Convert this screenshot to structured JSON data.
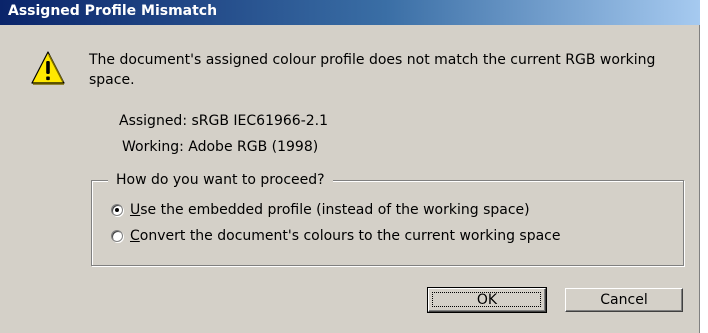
{
  "window": {
    "title": "Assigned Profile Mismatch"
  },
  "icon": {
    "name": "warning-icon",
    "fill": "#ffe800",
    "glyph": "!"
  },
  "message": "The document's assigned colour profile does not match the current RGB working space.",
  "assigned_text": "Assigned: sRGB IEC61966-2.1",
  "working_text": "Working: Adobe RGB (1998)",
  "group": {
    "legend": "How do you want to proceed?",
    "options": [
      {
        "accel": "U",
        "rest": "se the embedded profile (instead of the working space)",
        "selected": true
      },
      {
        "accel": "C",
        "rest": "onvert the document's colours to the current working space",
        "selected": false
      }
    ]
  },
  "buttons": {
    "ok_label": "OK",
    "cancel_label": "Cancel"
  },
  "colors": {
    "dialog_bg": "#d4d0c8",
    "title_start": "#0a246a",
    "title_end": "#a6caf0"
  }
}
